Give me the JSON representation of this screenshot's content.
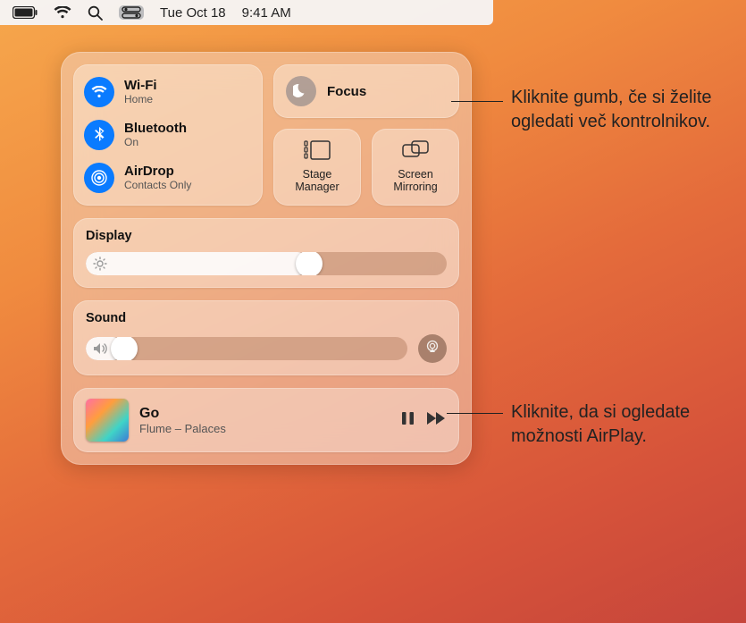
{
  "menubar": {
    "date": "Tue Oct 18",
    "time": "9:41 AM"
  },
  "connectivity": {
    "wifi": {
      "label": "Wi-Fi",
      "status": "Home"
    },
    "bluetooth": {
      "label": "Bluetooth",
      "status": "On"
    },
    "airdrop": {
      "label": "AirDrop",
      "status": "Contacts Only"
    }
  },
  "focus": {
    "label": "Focus"
  },
  "stage_manager": {
    "label": "Stage Manager"
  },
  "screen_mirroring": {
    "label": "Screen Mirroring"
  },
  "display": {
    "label": "Display",
    "value_pct": 62
  },
  "sound": {
    "label": "Sound",
    "value_pct": 12
  },
  "now_playing": {
    "title": "Go",
    "subtitle": "Flume – Palaces"
  },
  "callouts": {
    "focus": "Kliknite gumb, če si želite ogledati več kontrolnikov.",
    "airplay": "Kliknite, da si ogledate možnosti AirPlay."
  }
}
